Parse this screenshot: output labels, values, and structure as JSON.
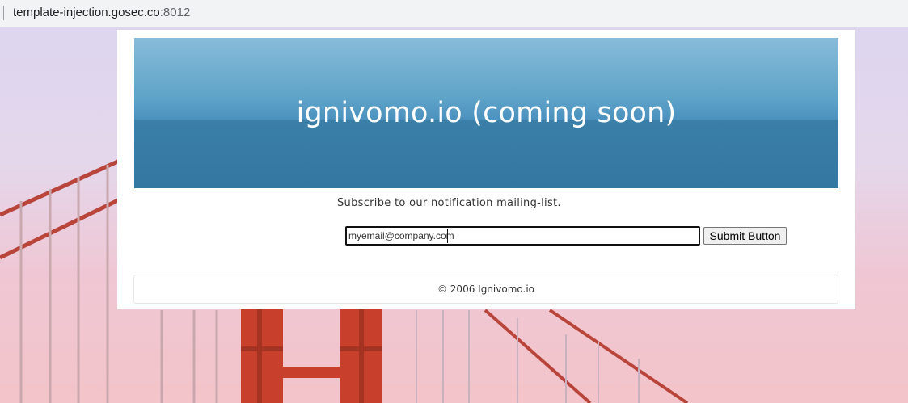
{
  "browser": {
    "url_host": "template-injection.gosec.co",
    "url_port": ":8012"
  },
  "page": {
    "banner_title": "ignivomo.io (coming soon)",
    "subscribe_text": "Subscribe to our notification mailing-list.",
    "email_value": "myemail@company.com",
    "submit_label": "Submit Button",
    "footer_text": "© 2006 Ignivomo.io"
  },
  "colors": {
    "banner_top": "#88bcd9",
    "banner_bottom": "#3478a2",
    "bridge_red": "#c4412f"
  }
}
